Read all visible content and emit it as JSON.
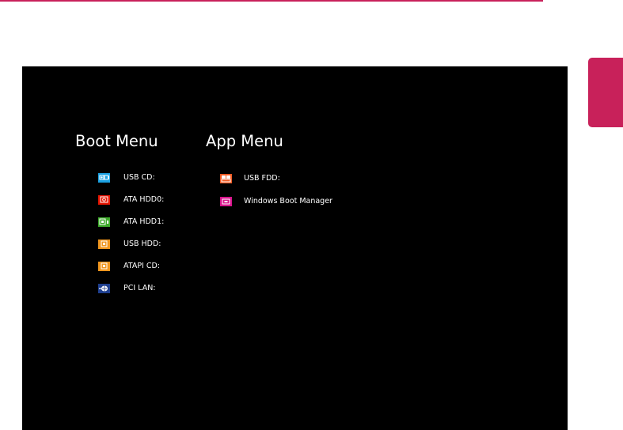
{
  "colors": {
    "accent_magenta": "#c8215a",
    "screen_bg": "#000000",
    "text": "#ffffff",
    "icon_blue": "#1ba1e2",
    "icon_red": "#e51400",
    "icon_green": "#3dab2a",
    "icon_orange": "#f0961e",
    "icon_navy": "#1e3f8f",
    "icon_orange_red": "#f05a23",
    "icon_pink": "#d8148c"
  },
  "boot_menu": {
    "title": "Boot Menu",
    "items": [
      {
        "label": "USB CD:",
        "icon": "usb-cd-icon",
        "color": "#1ba1e2"
      },
      {
        "label": "ATA HDD0:",
        "icon": "hdd-icon",
        "color": "#e51400"
      },
      {
        "label": "ATA HDD1:",
        "icon": "hdd-icon",
        "color": "#3dab2a"
      },
      {
        "label": "USB HDD:",
        "icon": "usb-hdd-icon",
        "color": "#f0961e"
      },
      {
        "label": "ATAPI CD:",
        "icon": "cd-icon",
        "color": "#f0961e"
      },
      {
        "label": "PCI LAN:",
        "icon": "network-icon",
        "color": "#1e3f8f"
      }
    ]
  },
  "app_menu": {
    "title": "App Menu",
    "items": [
      {
        "label": "USB FDD:",
        "icon": "floppy-icon",
        "color": "#f05a23"
      },
      {
        "label": "Windows Boot Manager",
        "icon": "windows-boot-icon",
        "color": "#d8148c"
      }
    ]
  }
}
